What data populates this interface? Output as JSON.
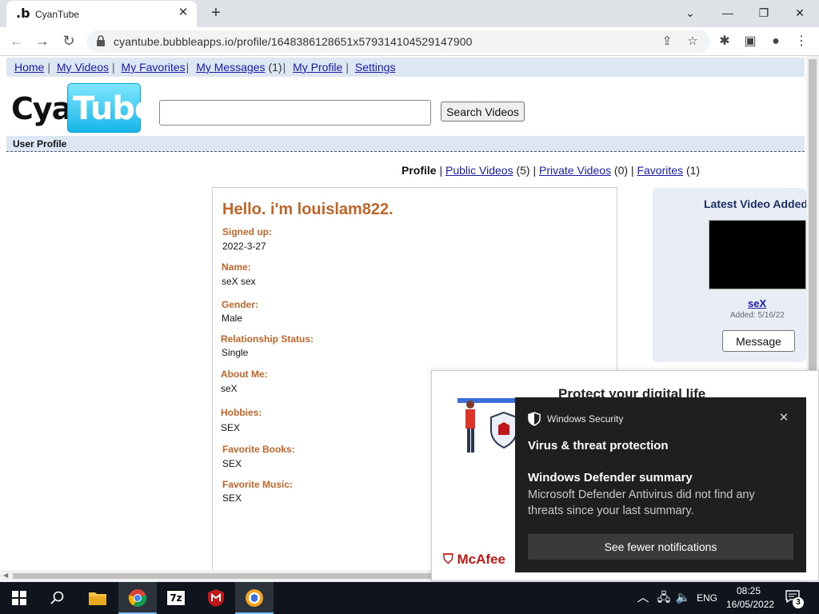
{
  "browser": {
    "tab_title": "CyanTube",
    "tab_favicon": ".b",
    "url": "cyantube.bubbleapps.io/profile/1648386128651x579314104529147900"
  },
  "site": {
    "nav": {
      "home": "Home",
      "my_videos": "My Videos",
      "my_favorites": "My Favorites",
      "my_messages": "My Messages",
      "messages_count": "(1)",
      "my_profile": "My Profile",
      "settings": "Settings"
    },
    "logo": {
      "part1": "Cyan",
      "part2": "Tube"
    },
    "search": {
      "value": "",
      "button": "Search Videos"
    },
    "section_title": "User Profile"
  },
  "profile_tabs": {
    "profile": "Profile",
    "public_videos": "Public Videos",
    "public_count": "(5)",
    "private_videos": "Private Videos",
    "private_count": "(0)",
    "favorites": "Favorites",
    "favorites_count": "(1)"
  },
  "profile": {
    "hello": "Hello. i'm louislam822.",
    "fields": [
      {
        "label": "Signed up:",
        "value": "2022-3-27"
      },
      {
        "label": "Name:",
        "value": "seX sex"
      },
      {
        "label": "Gender:",
        "value": "Male"
      },
      {
        "label": "Relationship Status:",
        "value": "Single"
      },
      {
        "label": "About Me:",
        "value": "seX"
      },
      {
        "label": "Hobbies:",
        "value": "SEX"
      },
      {
        "label": "Favorite Books:",
        "value": "SEX"
      },
      {
        "label": "Favorite Music:",
        "value": "SEX"
      }
    ]
  },
  "latest_video": {
    "title": "Latest Video Added",
    "video_title": "seX",
    "added": "Added: 5/16/22",
    "message_button": "Message"
  },
  "mcafee": {
    "headline": "Protect your digital life",
    "brand": "McAfee"
  },
  "toast": {
    "app": "Windows Security",
    "heading": "Virus & threat protection",
    "subheading": "Windows Defender summary",
    "body": "Microsoft Defender Antivirus did not find any threats since your last summary.",
    "button": "See fewer notifications"
  },
  "taskbar": {
    "language": "ENG",
    "time": "08:25",
    "date": "16/05/2022",
    "notification_count": "3"
  },
  "colors": {
    "link": "#1a1aa8",
    "label_orange": "#c0652a",
    "nav_bg": "#dce7f3",
    "toast_bg": "#1f1f1f",
    "taskbar_bg": "#10151d"
  }
}
